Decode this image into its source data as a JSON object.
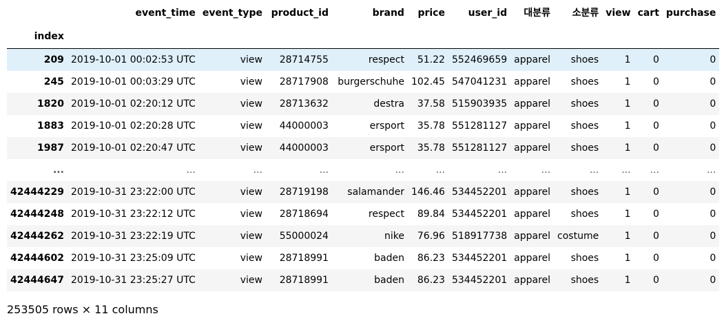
{
  "table": {
    "columns": [
      "event_time",
      "event_type",
      "product_id",
      "brand",
      "price",
      "user_id",
      "대분류",
      "소분류",
      "view",
      "cart",
      "purchase"
    ],
    "index_name": "index",
    "rows": [
      {
        "index": "209",
        "cells": [
          "2019-10-01 00:02:53 UTC",
          "view",
          "28714755",
          "respect",
          "51.22",
          "552469659",
          "apparel",
          "shoes",
          "1",
          "0",
          "0"
        ]
      },
      {
        "index": "245",
        "cells": [
          "2019-10-01 00:03:29 UTC",
          "view",
          "28717908",
          "burgerschuhe",
          "102.45",
          "547041231",
          "apparel",
          "shoes",
          "1",
          "0",
          "0"
        ]
      },
      {
        "index": "1820",
        "cells": [
          "2019-10-01 02:20:12 UTC",
          "view",
          "28713632",
          "destra",
          "37.58",
          "515903935",
          "apparel",
          "shoes",
          "1",
          "0",
          "0"
        ]
      },
      {
        "index": "1883",
        "cells": [
          "2019-10-01 02:20:28 UTC",
          "view",
          "44000003",
          "ersport",
          "35.78",
          "551281127",
          "apparel",
          "shoes",
          "1",
          "0",
          "0"
        ]
      },
      {
        "index": "1987",
        "cells": [
          "2019-10-01 02:20:47 UTC",
          "view",
          "44000003",
          "ersport",
          "35.78",
          "551281127",
          "apparel",
          "shoes",
          "1",
          "0",
          "0"
        ]
      },
      {
        "index": "...",
        "cells": [
          "...",
          "...",
          "...",
          "...",
          "...",
          "...",
          "...",
          "...",
          "...",
          "...",
          "..."
        ]
      },
      {
        "index": "42444229",
        "cells": [
          "2019-10-31 23:22:00 UTC",
          "view",
          "28719198",
          "salamander",
          "146.46",
          "534452201",
          "apparel",
          "shoes",
          "1",
          "0",
          "0"
        ]
      },
      {
        "index": "42444248",
        "cells": [
          "2019-10-31 23:22:12 UTC",
          "view",
          "28718694",
          "respect",
          "89.84",
          "534452201",
          "apparel",
          "shoes",
          "1",
          "0",
          "0"
        ]
      },
      {
        "index": "42444262",
        "cells": [
          "2019-10-31 23:22:19 UTC",
          "view",
          "55000024",
          "nike",
          "76.96",
          "518917738",
          "apparel",
          "costume",
          "1",
          "0",
          "0"
        ]
      },
      {
        "index": "42444602",
        "cells": [
          "2019-10-31 23:25:09 UTC",
          "view",
          "28718991",
          "baden",
          "86.23",
          "534452201",
          "apparel",
          "shoes",
          "1",
          "0",
          "0"
        ]
      },
      {
        "index": "42444647",
        "cells": [
          "2019-10-31 23:25:27 UTC",
          "view",
          "28718991",
          "baden",
          "86.23",
          "534452201",
          "apparel",
          "shoes",
          "1",
          "0",
          "0"
        ]
      }
    ],
    "highlighted_row": 0,
    "highlight_color": "#dff0fb",
    "stripe_color": "#f5f5f5"
  },
  "footer": {
    "shape_text": "253505 rows × 11 columns"
  }
}
